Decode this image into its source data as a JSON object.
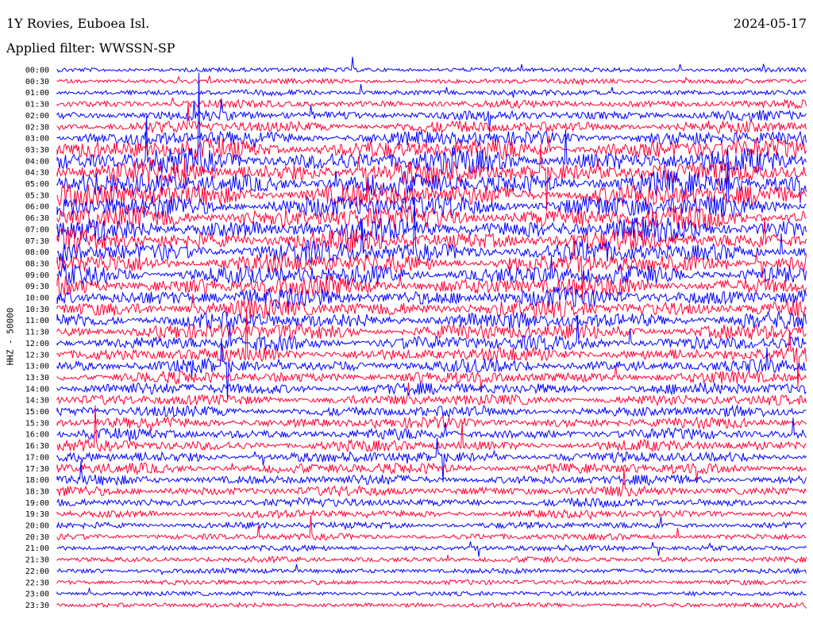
{
  "header": {
    "station": "1Y Rovies, Euboea Isl.",
    "date": "2024-05-17",
    "filter": "Applied filter: WWSSN-SP"
  },
  "colors": {
    "trace_a": "#0000ff",
    "trace_b": "#ff0033",
    "background": "#ffffff"
  },
  "chart_data": {
    "type": "helicorder",
    "ylabel": "HHZ - 50000",
    "rows": [
      "00:00",
      "00:30",
      "01:00",
      "01:30",
      "02:00",
      "02:30",
      "03:00",
      "03:30",
      "04:00",
      "04:30",
      "05:00",
      "05:30",
      "06:00",
      "06:30",
      "07:00",
      "07:30",
      "08:00",
      "08:30",
      "09:00",
      "09:30",
      "10:00",
      "10:30",
      "11:00",
      "11:30",
      "12:00",
      "12:30",
      "13:00",
      "13:30",
      "14:00",
      "14:30",
      "15:00",
      "15:30",
      "16:00",
      "16:30",
      "17:00",
      "17:30",
      "18:00",
      "18:30",
      "19:00",
      "19:30",
      "20:00",
      "20:30",
      "21:00",
      "21:30",
      "22:00",
      "22:30",
      "23:00",
      "23:30"
    ],
    "activity": [
      0.1,
      0.12,
      0.15,
      0.25,
      0.35,
      0.45,
      0.6,
      0.85,
      1.0,
      1.0,
      1.0,
      1.0,
      1.0,
      1.0,
      0.95,
      0.9,
      0.9,
      0.85,
      0.85,
      0.8,
      0.8,
      0.75,
      0.7,
      0.65,
      0.6,
      0.55,
      0.5,
      0.45,
      0.45,
      0.4,
      0.4,
      0.4,
      0.4,
      0.4,
      0.4,
      0.4,
      0.35,
      0.35,
      0.3,
      0.25,
      0.2,
      0.18,
      0.15,
      0.15,
      0.12,
      0.12,
      0.1,
      0.1
    ]
  }
}
